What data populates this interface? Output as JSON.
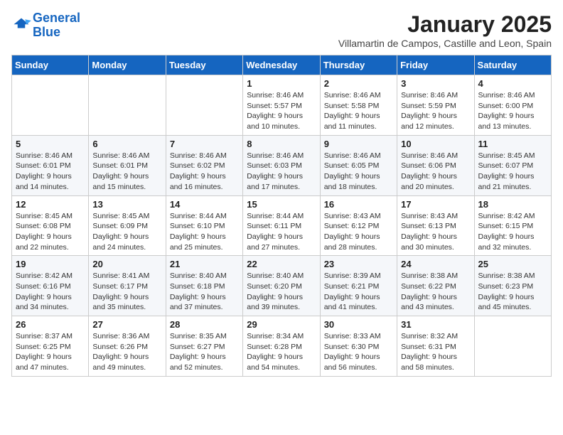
{
  "logo": {
    "line1": "General",
    "line2": "Blue"
  },
  "title": "January 2025",
  "subtitle": "Villamartin de Campos, Castille and Leon, Spain",
  "weekdays": [
    "Sunday",
    "Monday",
    "Tuesday",
    "Wednesday",
    "Thursday",
    "Friday",
    "Saturday"
  ],
  "weeks": [
    [
      {
        "day": "",
        "info": ""
      },
      {
        "day": "",
        "info": ""
      },
      {
        "day": "",
        "info": ""
      },
      {
        "day": "1",
        "info": "Sunrise: 8:46 AM\nSunset: 5:57 PM\nDaylight: 9 hours\nand 10 minutes."
      },
      {
        "day": "2",
        "info": "Sunrise: 8:46 AM\nSunset: 5:58 PM\nDaylight: 9 hours\nand 11 minutes."
      },
      {
        "day": "3",
        "info": "Sunrise: 8:46 AM\nSunset: 5:59 PM\nDaylight: 9 hours\nand 12 minutes."
      },
      {
        "day": "4",
        "info": "Sunrise: 8:46 AM\nSunset: 6:00 PM\nDaylight: 9 hours\nand 13 minutes."
      }
    ],
    [
      {
        "day": "5",
        "info": "Sunrise: 8:46 AM\nSunset: 6:01 PM\nDaylight: 9 hours\nand 14 minutes."
      },
      {
        "day": "6",
        "info": "Sunrise: 8:46 AM\nSunset: 6:01 PM\nDaylight: 9 hours\nand 15 minutes."
      },
      {
        "day": "7",
        "info": "Sunrise: 8:46 AM\nSunset: 6:02 PM\nDaylight: 9 hours\nand 16 minutes."
      },
      {
        "day": "8",
        "info": "Sunrise: 8:46 AM\nSunset: 6:03 PM\nDaylight: 9 hours\nand 17 minutes."
      },
      {
        "day": "9",
        "info": "Sunrise: 8:46 AM\nSunset: 6:05 PM\nDaylight: 9 hours\nand 18 minutes."
      },
      {
        "day": "10",
        "info": "Sunrise: 8:46 AM\nSunset: 6:06 PM\nDaylight: 9 hours\nand 20 minutes."
      },
      {
        "day": "11",
        "info": "Sunrise: 8:45 AM\nSunset: 6:07 PM\nDaylight: 9 hours\nand 21 minutes."
      }
    ],
    [
      {
        "day": "12",
        "info": "Sunrise: 8:45 AM\nSunset: 6:08 PM\nDaylight: 9 hours\nand 22 minutes."
      },
      {
        "day": "13",
        "info": "Sunrise: 8:45 AM\nSunset: 6:09 PM\nDaylight: 9 hours\nand 24 minutes."
      },
      {
        "day": "14",
        "info": "Sunrise: 8:44 AM\nSunset: 6:10 PM\nDaylight: 9 hours\nand 25 minutes."
      },
      {
        "day": "15",
        "info": "Sunrise: 8:44 AM\nSunset: 6:11 PM\nDaylight: 9 hours\nand 27 minutes."
      },
      {
        "day": "16",
        "info": "Sunrise: 8:43 AM\nSunset: 6:12 PM\nDaylight: 9 hours\nand 28 minutes."
      },
      {
        "day": "17",
        "info": "Sunrise: 8:43 AM\nSunset: 6:13 PM\nDaylight: 9 hours\nand 30 minutes."
      },
      {
        "day": "18",
        "info": "Sunrise: 8:42 AM\nSunset: 6:15 PM\nDaylight: 9 hours\nand 32 minutes."
      }
    ],
    [
      {
        "day": "19",
        "info": "Sunrise: 8:42 AM\nSunset: 6:16 PM\nDaylight: 9 hours\nand 34 minutes."
      },
      {
        "day": "20",
        "info": "Sunrise: 8:41 AM\nSunset: 6:17 PM\nDaylight: 9 hours\nand 35 minutes."
      },
      {
        "day": "21",
        "info": "Sunrise: 8:40 AM\nSunset: 6:18 PM\nDaylight: 9 hours\nand 37 minutes."
      },
      {
        "day": "22",
        "info": "Sunrise: 8:40 AM\nSunset: 6:20 PM\nDaylight: 9 hours\nand 39 minutes."
      },
      {
        "day": "23",
        "info": "Sunrise: 8:39 AM\nSunset: 6:21 PM\nDaylight: 9 hours\nand 41 minutes."
      },
      {
        "day": "24",
        "info": "Sunrise: 8:38 AM\nSunset: 6:22 PM\nDaylight: 9 hours\nand 43 minutes."
      },
      {
        "day": "25",
        "info": "Sunrise: 8:38 AM\nSunset: 6:23 PM\nDaylight: 9 hours\nand 45 minutes."
      }
    ],
    [
      {
        "day": "26",
        "info": "Sunrise: 8:37 AM\nSunset: 6:25 PM\nDaylight: 9 hours\nand 47 minutes."
      },
      {
        "day": "27",
        "info": "Sunrise: 8:36 AM\nSunset: 6:26 PM\nDaylight: 9 hours\nand 49 minutes."
      },
      {
        "day": "28",
        "info": "Sunrise: 8:35 AM\nSunset: 6:27 PM\nDaylight: 9 hours\nand 52 minutes."
      },
      {
        "day": "29",
        "info": "Sunrise: 8:34 AM\nSunset: 6:28 PM\nDaylight: 9 hours\nand 54 minutes."
      },
      {
        "day": "30",
        "info": "Sunrise: 8:33 AM\nSunset: 6:30 PM\nDaylight: 9 hours\nand 56 minutes."
      },
      {
        "day": "31",
        "info": "Sunrise: 8:32 AM\nSunset: 6:31 PM\nDaylight: 9 hours\nand 58 minutes."
      },
      {
        "day": "",
        "info": ""
      }
    ]
  ]
}
